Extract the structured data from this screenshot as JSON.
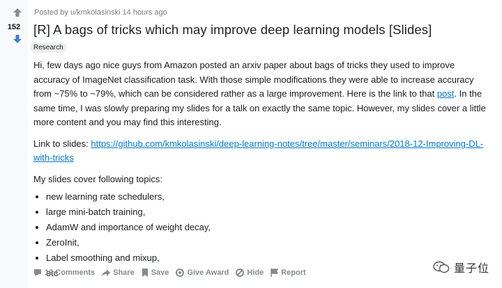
{
  "post": {
    "votes": "152",
    "meta": "Posted by u/kmkolasinski 14 hours ago",
    "title": "[R] A bags of tricks which may improve deep learning models [Slides]",
    "flair": "Research",
    "p1_before": "Hi, few days ago nice guys from Amazon posted an arxiv paper about bags of tricks they used to improve accuracy of ImageNet classification task. With those simple modifications they were able to increase accuracy from ~75% to ~79%, which can be considered rather as a large improvement. Here is the link to that ",
    "p1_link": "post",
    "p1_after": ". In the same time, I was slowly preparing my slides for a talk on exactly the same topic. However, my slides cover a little more content and you may find this interesting.",
    "slides_prefix": "Link to slides: ",
    "slides_link": "https://github.com/kmkolasinski/deep-learning-notes/tree/master/seminars/2018-12-Improving-DL-with-tricks",
    "topics_intro": "My slides cover following topics:",
    "topics": [
      "new learning rate schedulers,",
      "large mini-batch training,",
      "AdamW and importance of weight decay,",
      "ZeroInit,",
      "Label smoothing and mixup,",
      "etc"
    ]
  },
  "actions": {
    "comments": "12 Comments",
    "share": "Share",
    "save": "Save",
    "award": "Give Award",
    "hide": "Hide",
    "report": "Report"
  },
  "watermark": {
    "text": "量子位"
  }
}
